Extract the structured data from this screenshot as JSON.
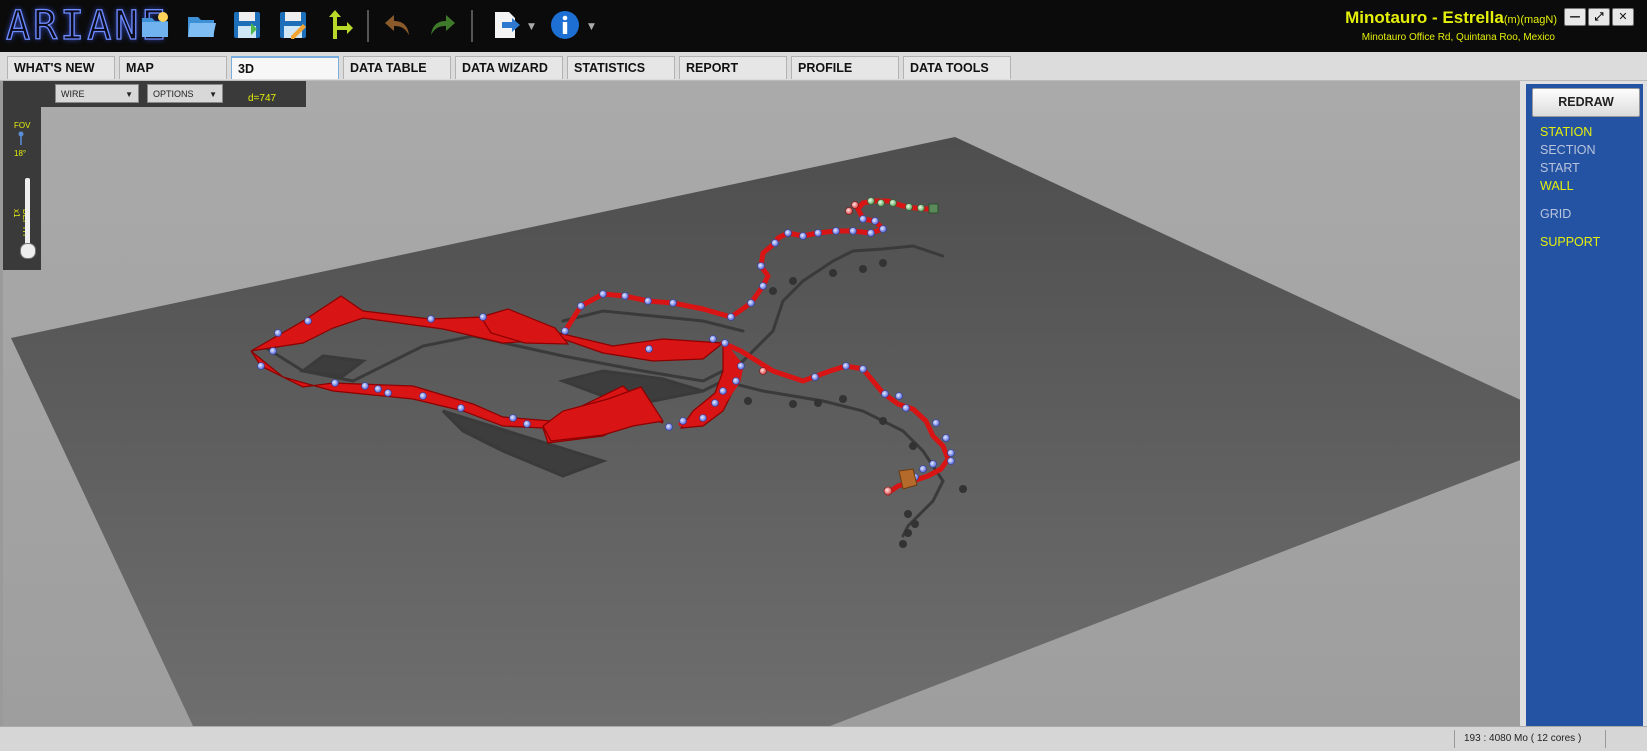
{
  "app": {
    "logo": "ARIANE"
  },
  "header": {
    "title": "Minotauro - Estrella",
    "title_units": "(m)(magN)",
    "location": "Minotauro Office Rd, Quintana Roo, Mexico"
  },
  "toolbar": {
    "icons": [
      "new-file-icon",
      "open-folder-icon",
      "save-icon",
      "save-as-icon",
      "branch-icon",
      "undo-icon",
      "redo-icon",
      "export-icon",
      "info-icon"
    ]
  },
  "tabs": [
    {
      "label": "WHAT'S NEW"
    },
    {
      "label": "MAP"
    },
    {
      "label": "3D"
    },
    {
      "label": "DATA TABLE"
    },
    {
      "label": "DATA WIZARD"
    },
    {
      "label": "STATISTICS"
    },
    {
      "label": "REPORT"
    },
    {
      "label": "PROFILE"
    },
    {
      "label": "DATA TOOLS"
    }
  ],
  "active_tab": "3D",
  "view_controls": {
    "render_mode": "WIRE",
    "options": "OPTIONS",
    "distance": "d=747",
    "fov_label": "FOV",
    "fov_value": "18°",
    "depth_label": "DEPTH x1"
  },
  "right_panel": {
    "redraw": "REDRAW",
    "options": [
      {
        "label": "STATION",
        "enabled": true
      },
      {
        "label": "SECTION",
        "enabled": false
      },
      {
        "label": "START",
        "enabled": false
      },
      {
        "label": "WALL",
        "enabled": true
      },
      {
        "label": "GRID",
        "enabled": false
      },
      {
        "label": "SUPPORT",
        "enabled": true
      }
    ],
    "colors": {
      "enabled": "#e5f00a",
      "disabled": "#b9c4dc",
      "panel": "#2453a4"
    }
  },
  "status": {
    "text": "193 :   4080 Mo ( 12 cores )"
  },
  "colors": {
    "accent_yellow": "#e5f00a",
    "cave_red": "#d81414",
    "station_blue": "#6a7ce8"
  }
}
